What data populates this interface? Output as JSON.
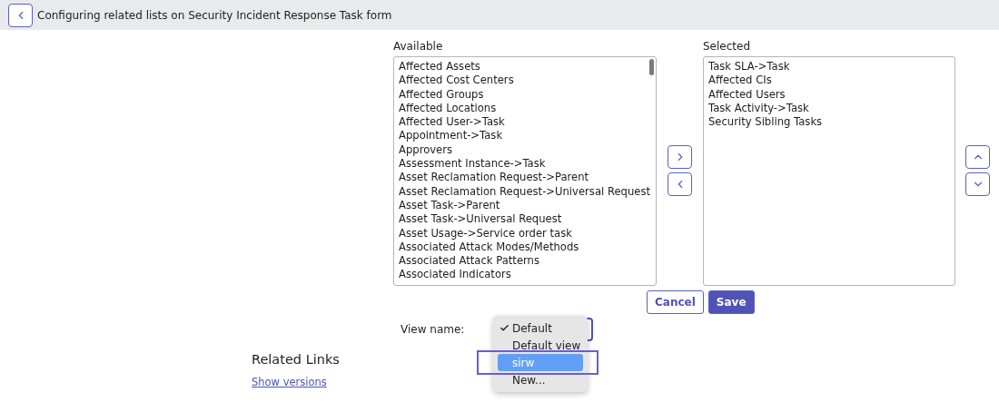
{
  "header": {
    "title": "Configuring related lists on Security Incident Response Task form"
  },
  "available": {
    "label": "Available",
    "items": [
      "Affected Assets",
      "Affected Cost Centers",
      "Affected Groups",
      "Affected Locations",
      "Affected User->Task",
      "Appointment->Task",
      "Approvers",
      "Assessment Instance->Task",
      "Asset Reclamation Request->Parent",
      "Asset Reclamation Request->Universal Request",
      "Asset Task->Parent",
      "Asset Task->Universal Request",
      "Asset Usage->Service order task",
      "Associated Attack Modes/Methods",
      "Associated Attack Patterns",
      "Associated Indicators"
    ]
  },
  "selected": {
    "label": "Selected",
    "items": [
      "Task SLA->Task",
      "Affected CIs",
      "Affected Users",
      "Task Activity->Task",
      "Security Sibling Tasks"
    ]
  },
  "buttons": [
    {
      "label": "Cancel",
      "kind": "secondary"
    },
    {
      "label": "Save",
      "kind": "primary"
    }
  ],
  "view": {
    "label": "View name:",
    "options": [
      {
        "label": "Default",
        "selected": true,
        "highlighted": false,
        "outlined": false
      },
      {
        "label": "Default view",
        "selected": false,
        "highlighted": false,
        "outlined": false
      },
      {
        "label": "sirw",
        "selected": false,
        "highlighted": true,
        "outlined": true
      },
      {
        "label": "New...",
        "selected": false,
        "highlighted": false,
        "outlined": false
      }
    ]
  },
  "related_links": {
    "title": "Related Links",
    "links": [
      "Show versions"
    ]
  }
}
